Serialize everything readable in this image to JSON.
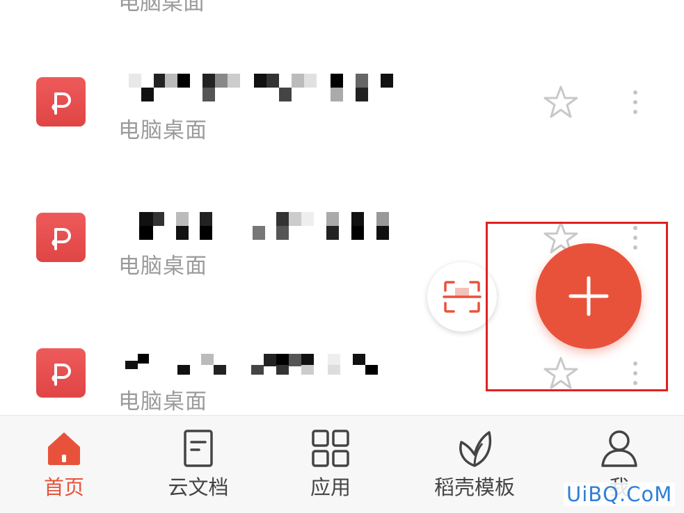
{
  "partial_item": {
    "location": "电脑桌面"
  },
  "files": [
    {
      "location": "电脑桌面"
    },
    {
      "location": "电脑桌面"
    },
    {
      "location": "电脑桌面"
    }
  ],
  "tabs": [
    {
      "label": "首页",
      "icon": "home-icon",
      "active": true
    },
    {
      "label": "云文档",
      "icon": "document-icon",
      "active": false
    },
    {
      "label": "应用",
      "icon": "apps-grid-icon",
      "active": false
    },
    {
      "label": "稻壳模板",
      "icon": "leaf-icon",
      "active": false
    },
    {
      "label": "我",
      "icon": "user-icon",
      "active": false
    }
  ],
  "watermark": "UiBQ.CoM",
  "colors": {
    "accent": "#e8523b",
    "file_icon": "#e04545",
    "highlight": "#e02020",
    "watermark": "#2f7fd6"
  }
}
